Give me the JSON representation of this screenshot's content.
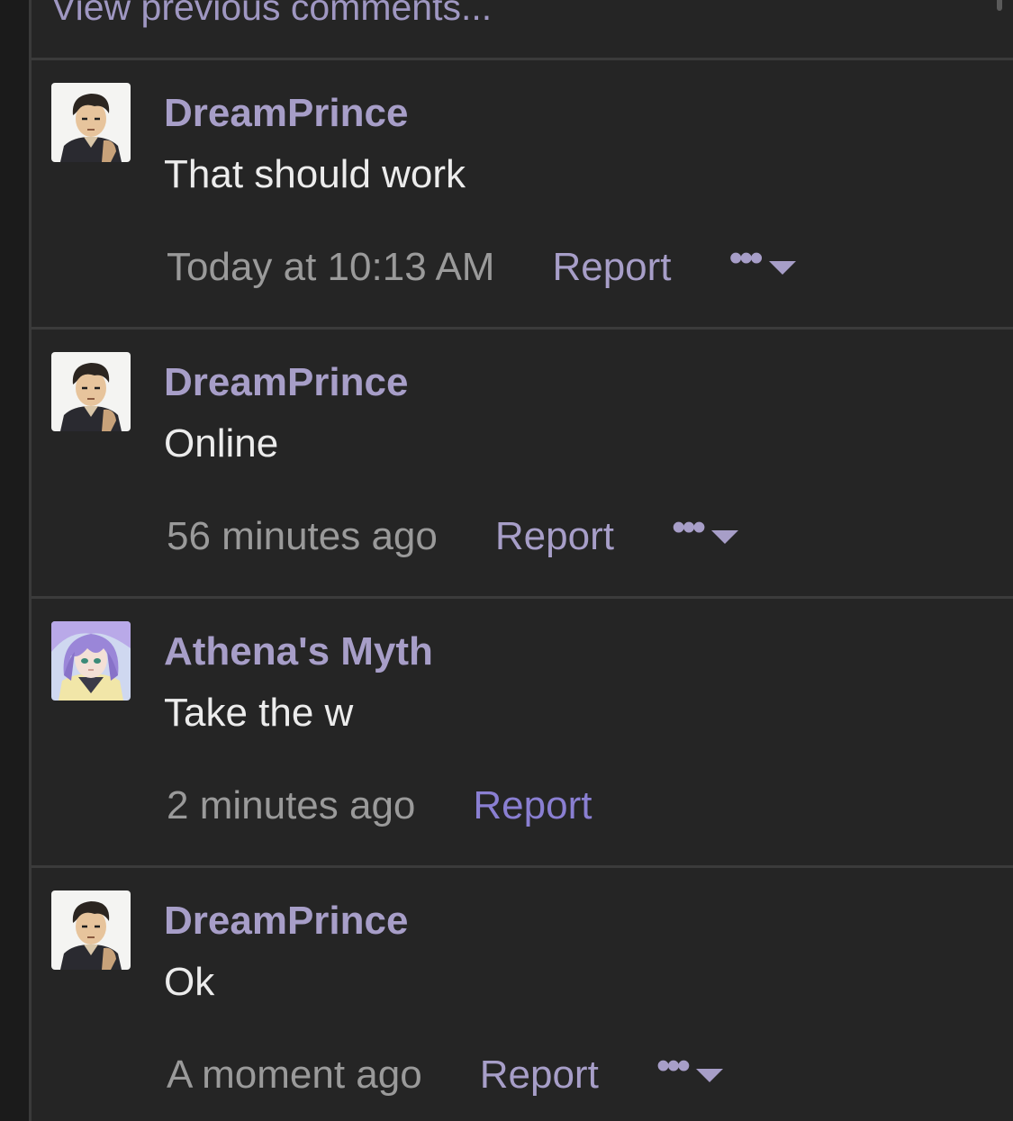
{
  "thread": {
    "view_previous_label": "View previous comments..."
  },
  "comments": [
    {
      "username": "DreamPrince",
      "text": "That should work",
      "timestamp": "Today at 10:13 AM",
      "report_label": "Report",
      "avatar_icon": "male-anime-avatar-icon",
      "has_more_menu": true
    },
    {
      "username": "DreamPrince",
      "text": "Online",
      "timestamp": "56 minutes ago",
      "report_label": "Report",
      "avatar_icon": "male-anime-avatar-icon",
      "has_more_menu": true
    },
    {
      "username": "Athena's Myth",
      "text": "Take the w",
      "timestamp": "2 minutes ago",
      "report_label": "Report",
      "avatar_icon": "purple-hair-anime-avatar-icon",
      "has_more_menu": false
    },
    {
      "username": "DreamPrince",
      "text": "Ok",
      "timestamp": "A moment ago",
      "report_label": "Report",
      "avatar_icon": "male-anime-avatar-icon",
      "has_more_menu": true
    }
  ],
  "colors": {
    "username": "#a79ec8",
    "report_link": "#a79ec8",
    "report_link_active": "#8a7fd2",
    "timestamp": "#9a9a9a",
    "body_text": "#ececec",
    "panel_bg": "#252525"
  }
}
